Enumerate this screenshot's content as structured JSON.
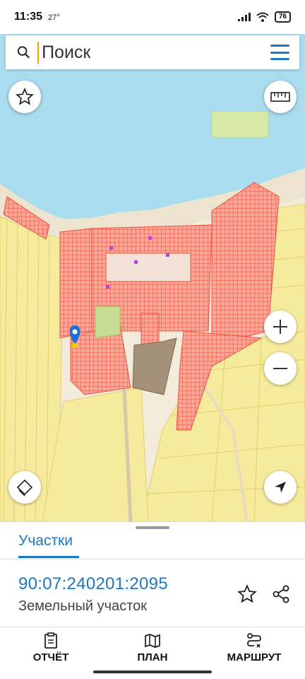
{
  "status": {
    "time": "11:35",
    "temp": "27°",
    "battery": "76"
  },
  "search": {
    "placeholder": "Поиск"
  },
  "map": {
    "colors": {
      "water": "#a9dcee",
      "land": "#f3ecda",
      "parcel_fill": "#f6a99a",
      "parcel_stroke": "#e8533f",
      "farmland": "#f6ea9c",
      "building": "#a38f7a"
    },
    "controls": [
      "favorite-star",
      "ruler",
      "zoom-in",
      "zoom-out",
      "layers",
      "my-location"
    ]
  },
  "sheet": {
    "tab_label": "Участки",
    "parcel_id": "90:07:240201:2095",
    "parcel_type": "Земельный участок"
  },
  "nav": {
    "report": "ОТЧЁТ",
    "plan": "ПЛАН",
    "route": "МАРШРУТ"
  }
}
